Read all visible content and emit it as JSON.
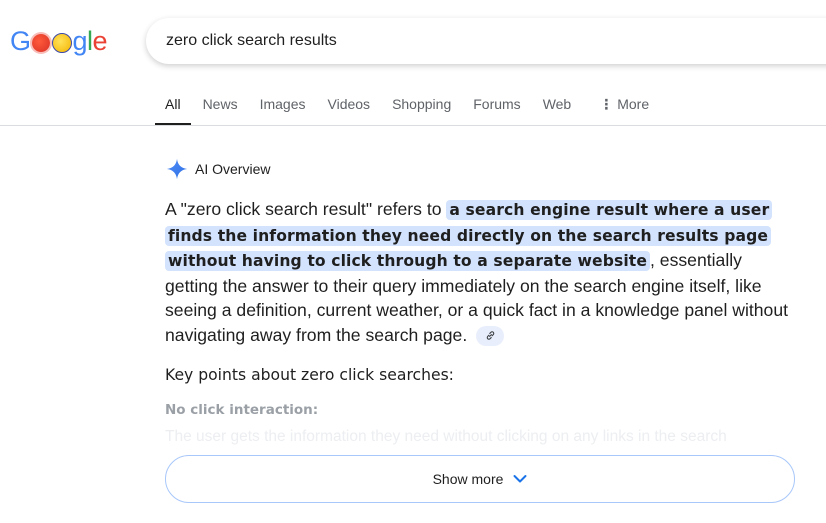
{
  "logo": {
    "letters": [
      "G",
      "o",
      "o",
      "g",
      "l",
      "e"
    ],
    "alt": "Google"
  },
  "search": {
    "query": "zero click search results"
  },
  "tabs": [
    {
      "label": "All",
      "active": true
    },
    {
      "label": "News"
    },
    {
      "label": "Images"
    },
    {
      "label": "Videos"
    },
    {
      "label": "Shopping"
    },
    {
      "label": "Forums"
    },
    {
      "label": "Web"
    },
    {
      "label": "More",
      "icon": "vertical-dots-icon"
    }
  ],
  "ai_overview": {
    "title": "AI Overview",
    "icon": "sparkle-icon",
    "accent_color": "#4285f4",
    "paragraph": {
      "lead": "A \"zero click search result\" refers to ",
      "highlight": "a search engine result where a user finds the information they need directly on the search results page without having to click through to a separate website",
      "tail": ", essentially getting the answer to their query immediately on the search engine itself, like seeing a definition, current weather, or a quick fact in a knowledge panel without navigating away from the search page.",
      "link_icon": "link-icon"
    },
    "key_points_heading": "Key points about zero click searches:",
    "subheading": "No click interaction:",
    "faded_text": "The user gets the information they need without clicking on any links in the search",
    "show_more_label": "Show more",
    "highlight_color": "#d3e3fd"
  }
}
